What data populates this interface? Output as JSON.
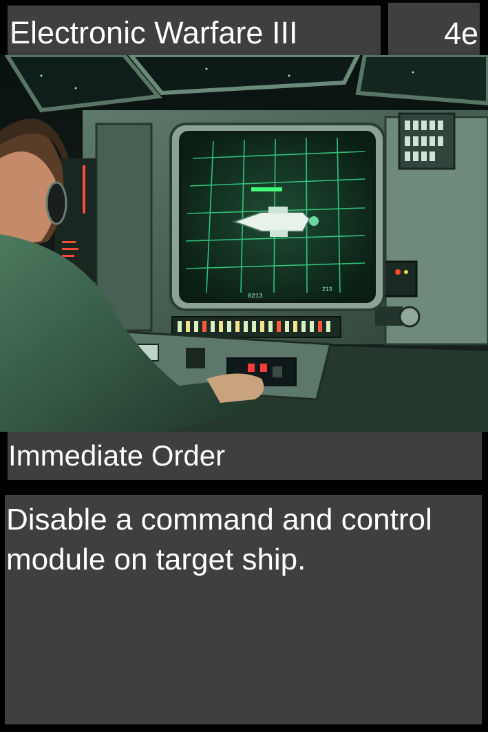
{
  "card": {
    "title": "Electronic Warfare III",
    "cost": "4e",
    "type": "Immediate Order",
    "rules_text": "Disable a command and control module on target ship.",
    "screen_label": "0213",
    "screen_label_2": "213"
  },
  "colors": {
    "panel": "#3f3f3f",
    "background": "#000000",
    "text": "#ffffff",
    "screen_glow": "#4dff9a"
  },
  "art": {
    "subject": "operator-at-radar-console-illustration"
  }
}
